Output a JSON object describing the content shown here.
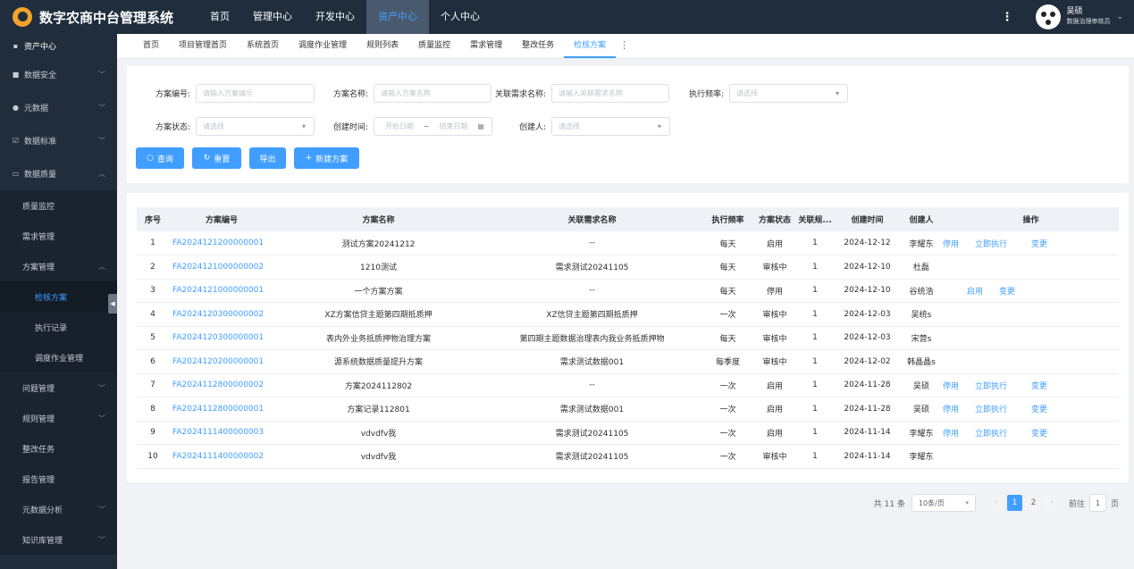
{
  "app": {
    "title": "数字农商中台管理系统"
  },
  "topnav": [
    "首页",
    "管理中心",
    "开发中心",
    "资产中心",
    "个人中心"
  ],
  "user": {
    "name": "吴硕",
    "role": "数据治理审核员"
  },
  "sidebar": {
    "head": "资产中心",
    "items": [
      "数据安全",
      "元数据",
      "数据标准",
      "数据质量"
    ],
    "quality_children": [
      "质量监控",
      "需求管理",
      "方案管理"
    ],
    "plan_children": [
      "检核方案",
      "执行记录",
      "调度作业管理"
    ],
    "rest": [
      "问题管理",
      "规则管理",
      "整改任务",
      "报告管理",
      "元数据分析",
      "知识库管理"
    ]
  },
  "tabs": [
    "首页",
    "项目管理首页",
    "系统首页",
    "调度作业管理",
    "规则列表",
    "质量监控",
    "需求管理",
    "整改任务",
    "检核方案"
  ],
  "filters": {
    "plan_code": {
      "label": "方案编号:",
      "placeholder": "请输入方案编号"
    },
    "plan_name": {
      "label": "方案名称:",
      "placeholder": "请输入方案名称"
    },
    "req_name": {
      "label": "关联需求名称:",
      "placeholder": "请输入关联需求名称"
    },
    "frequency": {
      "label": "执行频率:",
      "placeholder": "请选择"
    },
    "status": {
      "label": "方案状态:",
      "placeholder": "请选择"
    },
    "created": {
      "label": "创建时间:",
      "start": "开始日期",
      "sep": "~",
      "end": "结束日期"
    },
    "creator": {
      "label": "创建人:",
      "placeholder": "请选择"
    }
  },
  "buttons": {
    "query": "查询",
    "reset": "重置",
    "export": "导出",
    "new": "新建方案"
  },
  "table": {
    "headers": [
      "序号",
      "方案编号",
      "方案名称",
      "关联需求名称",
      "执行频率",
      "方案状态",
      "关联规...",
      "创建时间",
      "创建人",
      "操作"
    ],
    "rows": [
      {
        "no": "1",
        "code": "FA2024121200000001",
        "name": "测试方案20241212",
        "req": "--",
        "freq": "每天",
        "status": "启用",
        "rules": "1",
        "date": "2024-12-12",
        "creator": "李耀东",
        "ops": [
          "停用",
          "立即执行",
          "变更"
        ]
      },
      {
        "no": "2",
        "code": "FA2024121000000002",
        "name": "1210测试",
        "req": "需求测试20241105",
        "freq": "每天",
        "status": "审核中",
        "rules": "1",
        "date": "2024-12-10",
        "creator": "杜磊",
        "ops": []
      },
      {
        "no": "3",
        "code": "FA2024121000000001",
        "name": "一个方案方案",
        "req": "--",
        "freq": "每天",
        "status": "停用",
        "rules": "1",
        "date": "2024-12-10",
        "creator": "谷统浩",
        "ops": [
          "启用",
          "变更"
        ]
      },
      {
        "no": "4",
        "code": "FA2024120300000002",
        "name": "XZ方案信贷主题第四期抵质押",
        "req": "XZ信贷主题第四期抵质押",
        "freq": "一次",
        "status": "审核中",
        "rules": "1",
        "date": "2024-12-03",
        "creator": "吴统s",
        "ops": []
      },
      {
        "no": "5",
        "code": "FA2024120300000001",
        "name": "表内外业务抵质押物治理方案",
        "req": "第四期主题数据治理表内我业务抵质押物",
        "freq": "每天",
        "status": "审核中",
        "rules": "1",
        "date": "2024-12-03",
        "creator": "宋营s",
        "ops": []
      },
      {
        "no": "6",
        "code": "FA2024120200000001",
        "name": "源系统数据质量提升方案",
        "req": "需求测试数据001",
        "freq": "每季度",
        "status": "审核中",
        "rules": "1",
        "date": "2024-12-02",
        "creator": "韩晶晶s",
        "ops": []
      },
      {
        "no": "7",
        "code": "FA2024112800000002",
        "name": "方案2024112802",
        "req": "--",
        "freq": "一次",
        "status": "启用",
        "rules": "1",
        "date": "2024-11-28",
        "creator": "吴硕",
        "ops": [
          "停用",
          "立即执行",
          "变更"
        ]
      },
      {
        "no": "8",
        "code": "FA2024112800000001",
        "name": "方案记录112801",
        "req": "需求测试数据001",
        "freq": "一次",
        "status": "启用",
        "rules": "1",
        "date": "2024-11-28",
        "creator": "吴硕",
        "ops": [
          "停用",
          "立即执行",
          "变更"
        ]
      },
      {
        "no": "9",
        "code": "FA2024111400000003",
        "name": "vdvdfv我",
        "req": "需求测试20241105",
        "freq": "一次",
        "status": "启用",
        "rules": "1",
        "date": "2024-11-14",
        "creator": "李耀东",
        "ops": [
          "停用",
          "立即执行",
          "变更"
        ]
      },
      {
        "no": "10",
        "code": "FA2024111400000002",
        "name": "vdvdfv我",
        "req": "需求测试20241105",
        "freq": "一次",
        "status": "审核中",
        "rules": "1",
        "date": "2024-11-14",
        "creator": "李耀东",
        "ops": []
      }
    ]
  },
  "pagination": {
    "total": "共 11 条",
    "page_size": "10条/页",
    "pages": [
      "1",
      "2"
    ],
    "goto_label": "前往",
    "goto_value": "1",
    "goto_suffix": "页"
  },
  "colors": {
    "accent": "#409eff",
    "header_bg": "#1f2d3d",
    "sidebar_bg": "#222d3c"
  }
}
